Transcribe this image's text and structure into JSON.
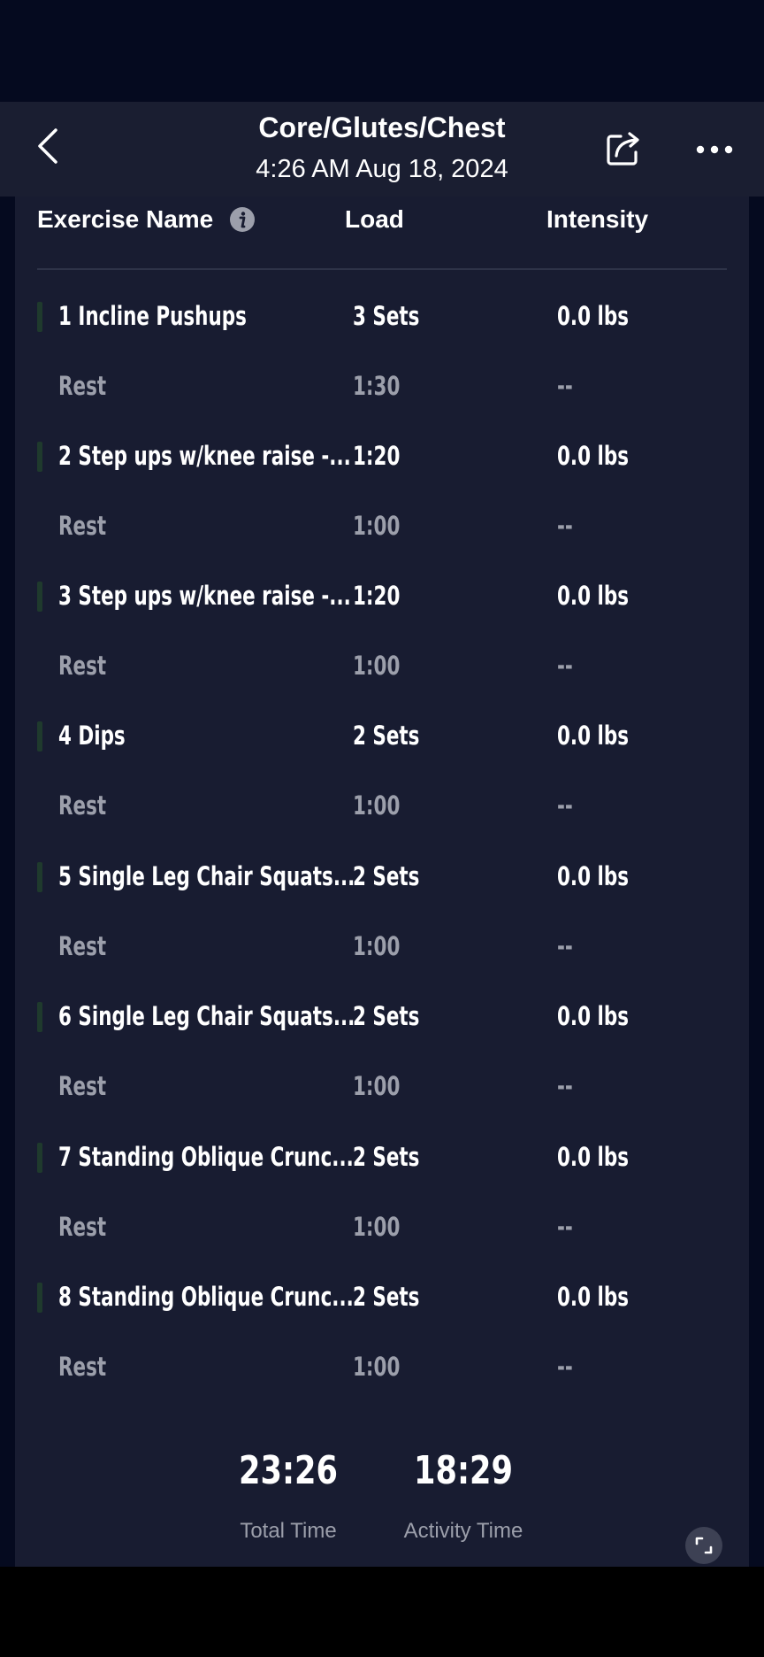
{
  "header": {
    "title": "Core/Glutes/Chest",
    "datetime": "4:26 AM Aug 18, 2024",
    "back_icon": "chevron-left-icon",
    "share_icon": "share-icon",
    "more_icon": "more-horizontal-icon"
  },
  "columns": {
    "name": "Exercise Name",
    "load": "Load",
    "intensity": "Intensity",
    "info_icon": "info-icon"
  },
  "rows": [
    {
      "type": "exercise",
      "name": "1 Incline Pushups",
      "load": "3 Sets",
      "intensity": "0.0 lbs"
    },
    {
      "type": "rest",
      "name": "Rest",
      "load": "1:30",
      "intensity": "--"
    },
    {
      "type": "exercise",
      "name": "2 Step ups w/knee raise -...",
      "load": "1:20",
      "intensity": "0.0 lbs"
    },
    {
      "type": "rest",
      "name": "Rest",
      "load": "1:00",
      "intensity": "--"
    },
    {
      "type": "exercise",
      "name": "3 Step ups w/knee raise -...",
      "load": "1:20",
      "intensity": "0.0 lbs"
    },
    {
      "type": "rest",
      "name": "Rest",
      "load": "1:00",
      "intensity": "--"
    },
    {
      "type": "exercise",
      "name": "4 Dips",
      "load": "2 Sets",
      "intensity": "0.0 lbs"
    },
    {
      "type": "rest",
      "name": "Rest",
      "load": "1:00",
      "intensity": "--"
    },
    {
      "type": "exercise",
      "name": "5 Single Leg Chair Squats...",
      "load": "2 Sets",
      "intensity": "0.0 lbs"
    },
    {
      "type": "rest",
      "name": "Rest",
      "load": "1:00",
      "intensity": "--"
    },
    {
      "type": "exercise",
      "name": "6 Single Leg Chair Squats...",
      "load": "2 Sets",
      "intensity": "0.0 lbs"
    },
    {
      "type": "rest",
      "name": "Rest",
      "load": "1:00",
      "intensity": "--"
    },
    {
      "type": "exercise",
      "name": "7 Standing Oblique Crunc...",
      "load": "2 Sets",
      "intensity": "0.0 lbs"
    },
    {
      "type": "rest",
      "name": "Rest",
      "load": "1:00",
      "intensity": "--"
    },
    {
      "type": "exercise",
      "name": "8 Standing Oblique Crunc...",
      "load": "2 Sets",
      "intensity": "0.0 lbs"
    },
    {
      "type": "rest",
      "name": "Rest",
      "load": "1:00",
      "intensity": "--"
    }
  ],
  "summary": {
    "total_time": "23:26",
    "total_time_label": "Total Time",
    "activity_time": "18:29",
    "activity_time_label": "Activity Time",
    "expand_icon": "expand-icon"
  },
  "colors": {
    "background": "#050a1f",
    "header": "#1a1e31",
    "panel": "#181c31",
    "muted_text": "#9c9fab",
    "exercise_marker": "#1f3a2d"
  }
}
